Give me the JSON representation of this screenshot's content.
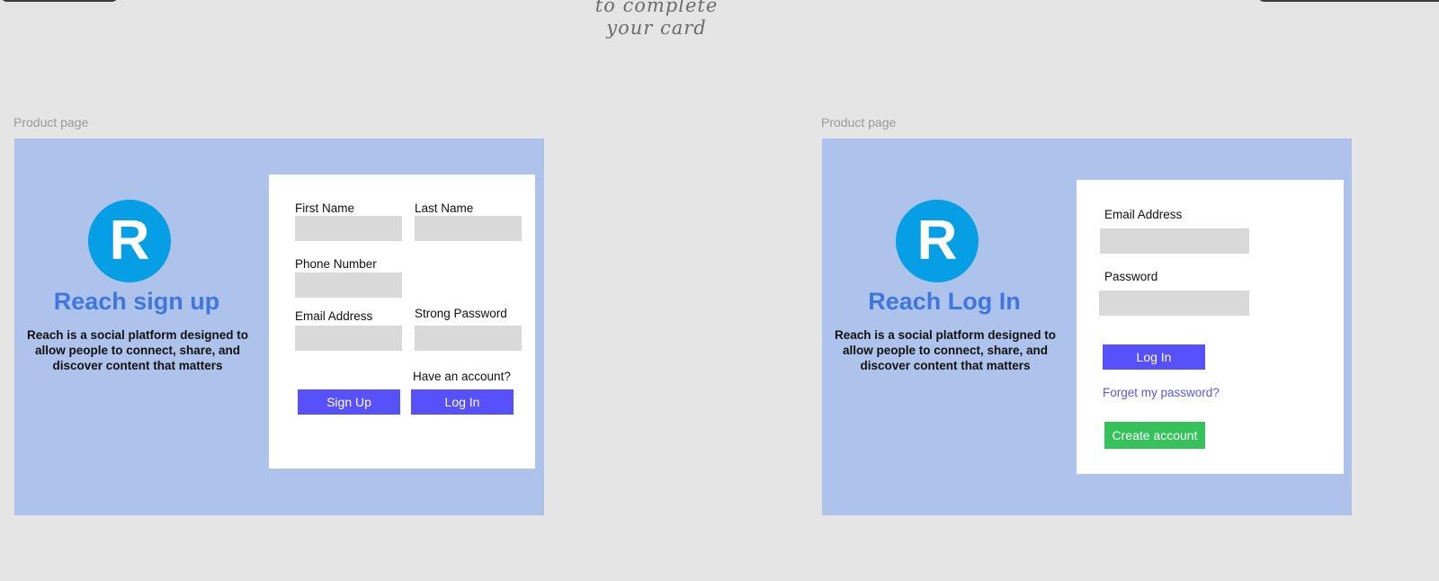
{
  "canvas_note": {
    "line1": "to complete",
    "line2": "your card"
  },
  "signup_frame": {
    "label": "Product page",
    "logo_letter": "R",
    "title": "Reach sign up",
    "description": "Reach is a social platform designed to allow people to connect, share, and discover content that matters",
    "form": {
      "first_name_label": "First Name",
      "first_name_value": "",
      "last_name_label": "Last Name",
      "last_name_value": "",
      "phone_label": "Phone Number",
      "phone_value": "",
      "email_label": "Email Address",
      "email_value": "",
      "password_label": "Strong Password",
      "password_value": "",
      "have_account_text": "Have an account?",
      "signup_button": "Sign Up",
      "login_button": "Log In"
    }
  },
  "login_frame": {
    "label": "Product page",
    "logo_letter": "R",
    "title": "Reach Log In",
    "description": "Reach is a social platform designed to allow people to connect, share, and discover content that matters",
    "form": {
      "email_label": "Email Address",
      "email_value": "",
      "password_label": "Password",
      "password_value": "",
      "login_button": "Log In",
      "forgot_link": "Forget my password?",
      "create_button": "Create account"
    }
  },
  "colors": {
    "canvas": "#e5e5e5",
    "frame_bg": "#aec3ec",
    "logo_bg": "#069ee5",
    "title": "#3f76e0",
    "primary_button": "#5751fc",
    "success_button": "#36c25a",
    "input_bg": "#d9d9d9"
  }
}
